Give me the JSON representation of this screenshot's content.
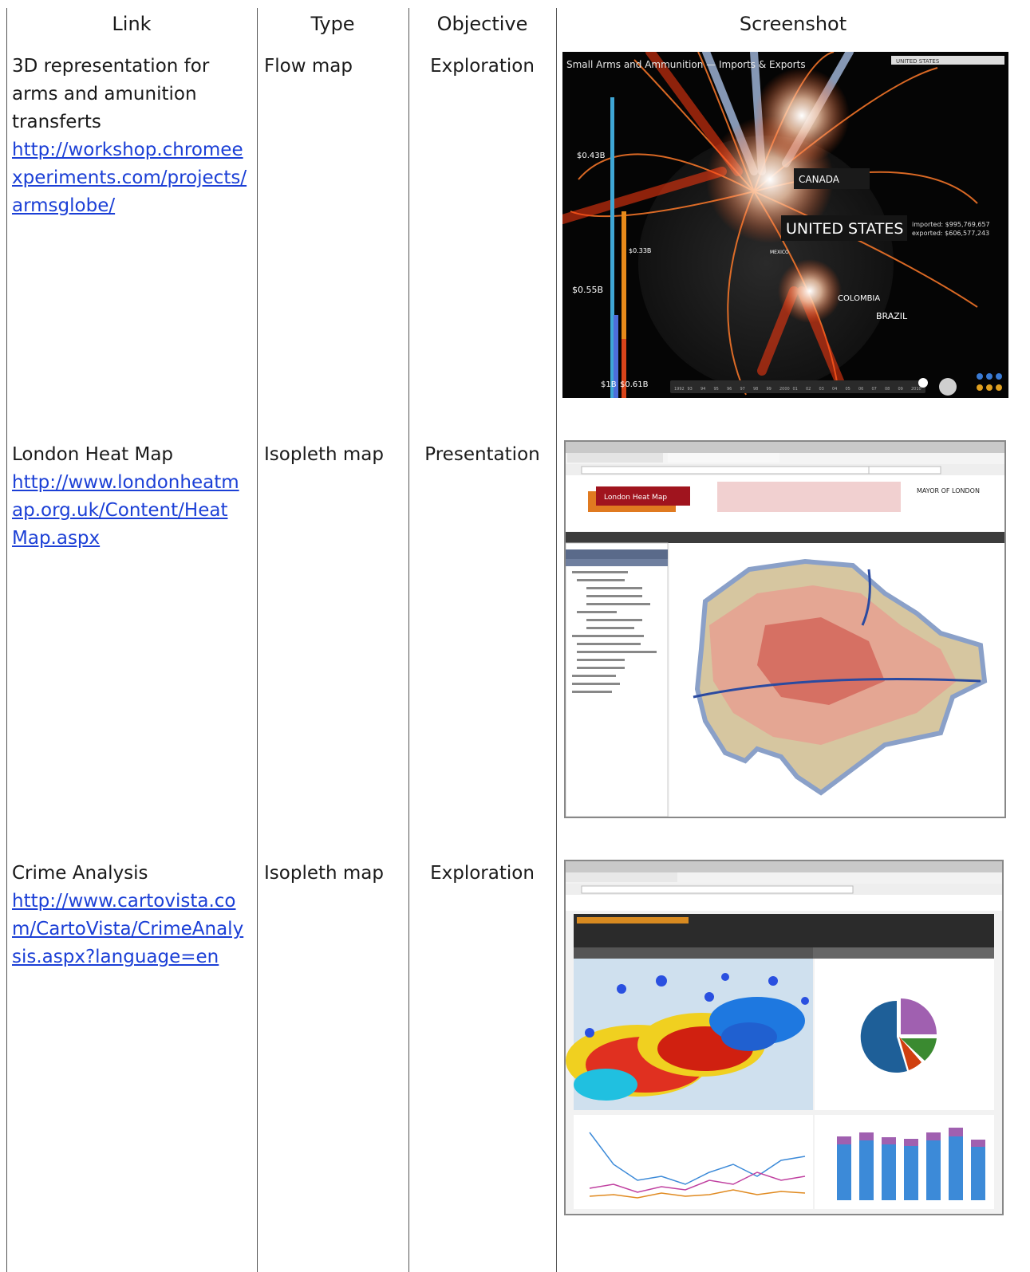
{
  "headers": {
    "link": "Link",
    "type": "Type",
    "objective": "Objective",
    "screenshot": "Screenshot"
  },
  "rows": [
    {
      "title_lines": [
        "3D representation for",
        "arms and amunition",
        "transferts"
      ],
      "url_lines": [
        "http://workshop.chromee",
        "xperiments.com/projects/",
        "armsglobe/"
      ],
      "type": "Flow map",
      "objective": "Exploration",
      "screenshot": {
        "title": "Small Arms and Ammunition — Imports & Exports",
        "search": "UNITED STATES",
        "labels": {
          "canada": "CANADA",
          "us": "UNITED STATES",
          "us_imported": "imported: $995,769,657",
          "us_exported": "exported: $606,577,243",
          "colombia": "COLOMBIA",
          "brazil": "BRAZIL",
          "mexico": "MEXICO",
          "v043": "$0.43B",
          "v033": "$0.33B",
          "v055": "$0.55B",
          "v1": "$1B",
          "v061": "$0.61B"
        },
        "timeline": [
          "1992",
          "93",
          "94",
          "95",
          "96",
          "97",
          "98",
          "99",
          "2000",
          "01",
          "02",
          "03",
          "04",
          "05",
          "06",
          "07",
          "08",
          "09",
          "2010"
        ]
      }
    },
    {
      "title_lines": [
        "London Heat Map"
      ],
      "url_lines": [
        "http://www.londonheatm",
        "ap.org.uk/Content/Heat",
        "Map.aspx"
      ],
      "type": "Isopleth map",
      "objective": "Presentation",
      "screenshot": {
        "banner": "London Heat Map",
        "mayor": "MAYOR OF LONDON"
      }
    },
    {
      "title_lines": [
        "Crime Analysis"
      ],
      "url_lines": [
        "http://www.cartovista.co",
        "m/CartoVista/CrimeAnaly",
        "sis.aspx?language=en"
      ],
      "type": "Isopleth map",
      "objective": "Exploration",
      "screenshot": {}
    }
  ]
}
